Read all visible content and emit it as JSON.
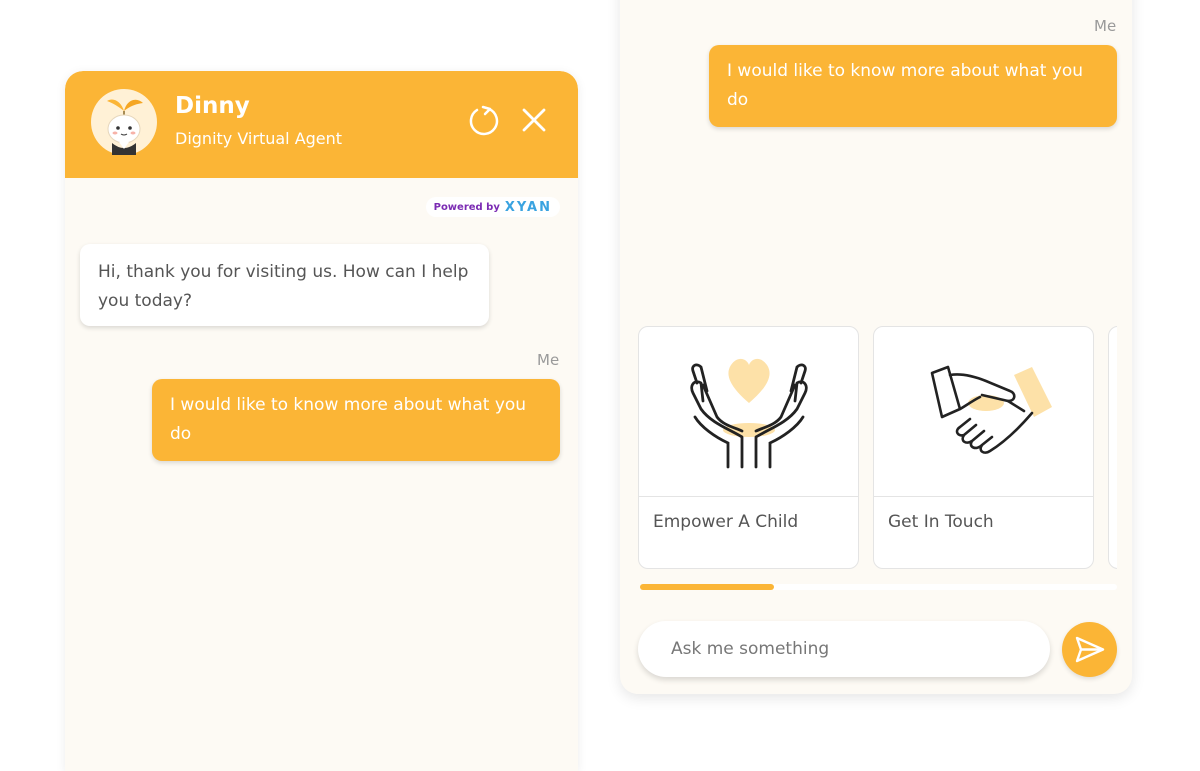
{
  "header": {
    "agent_name": "Dinny",
    "agent_subtitle": "Dignity Virtual Agent"
  },
  "powered_by": {
    "prefix": "Powered by",
    "brand": "XYAN"
  },
  "left_chat": {
    "bot_message": "Hi, thank you for visiting us. How can I help you today?",
    "me_label": "Me",
    "user_message": "I would like to know more about what you do"
  },
  "right_chat": {
    "me_label": "Me",
    "user_message": "I would like to know more about what you do",
    "cards": [
      {
        "title": "Empower A Child",
        "icon": "caring-hands-heart-icon"
      },
      {
        "title": "Get In Touch",
        "icon": "handshake-icon"
      }
    ],
    "carousel_progress": 0.28
  },
  "input": {
    "placeholder": "Ask me something"
  },
  "icons": {
    "refresh": "refresh-icon",
    "close": "close-icon",
    "send": "send-icon",
    "avatar": "mascot-avatar-icon"
  },
  "colors": {
    "accent": "#fbb536",
    "panel_bg": "#fdfaf4",
    "text": "#555555",
    "muted": "#9a9a9a",
    "brand_purple": "#7b2bb3",
    "brand_blue": "#3aa3e0"
  }
}
